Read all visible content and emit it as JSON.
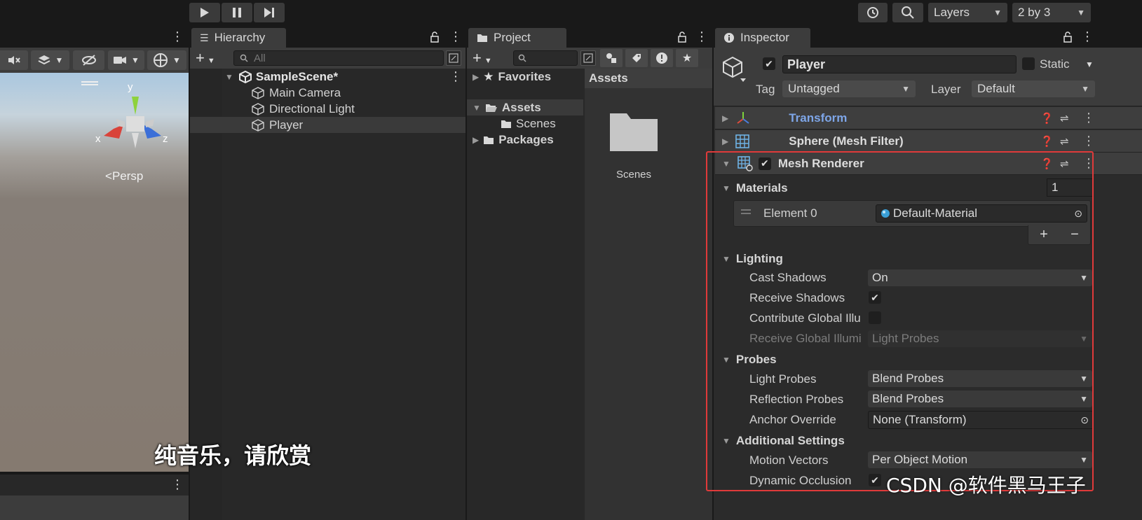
{
  "toolbar": {
    "layers_label": "Layers",
    "layout_label": "2 by 3"
  },
  "scene": {
    "persp_label": "Persp",
    "gizmo": {
      "y": "y",
      "x": "x",
      "z": "z"
    }
  },
  "hierarchy": {
    "tab_label": "Hierarchy",
    "search_placeholder": "All",
    "scene_name": "SampleScene*",
    "items": [
      "Main Camera",
      "Directional Light",
      "Player"
    ]
  },
  "project": {
    "tab_label": "Project",
    "favorites": "Favorites",
    "assets": "Assets",
    "scenes": "Scenes",
    "packages": "Packages",
    "assets_header": "Assets",
    "folder_label": "Scenes"
  },
  "inspector": {
    "tab_label": "Inspector",
    "object_name": "Player",
    "static_label": "Static",
    "tag_label": "Tag",
    "tag_value": "Untagged",
    "layer_label": "Layer",
    "layer_value": "Default",
    "components": {
      "transform": "Transform",
      "mesh_filter": "Sphere (Mesh Filter)",
      "mesh_renderer": "Mesh Renderer"
    },
    "materials": {
      "label": "Materials",
      "count": "1",
      "element_label": "Element 0",
      "element_value": "Default-Material"
    },
    "lighting": {
      "label": "Lighting",
      "cast_shadows_label": "Cast Shadows",
      "cast_shadows_value": "On",
      "receive_shadows_label": "Receive Shadows",
      "contribute_gi_label": "Contribute Global Illu",
      "receive_gi_label": "Receive Global Illumi",
      "receive_gi_value": "Light Probes"
    },
    "probes": {
      "label": "Probes",
      "light_probes_label": "Light Probes",
      "light_probes_value": "Blend Probes",
      "reflection_probes_label": "Reflection Probes",
      "reflection_probes_value": "Blend Probes",
      "anchor_override_label": "Anchor Override",
      "anchor_override_value": "None (Transform)"
    },
    "additional": {
      "label": "Additional Settings",
      "motion_vectors_label": "Motion Vectors",
      "motion_vectors_value": "Per Object Motion",
      "dynamic_occlusion_label": "Dynamic Occlusion"
    }
  },
  "overlay": {
    "subtitle": "纯音乐，请欣赏",
    "watermark": "CSDN @软件黑马王子"
  },
  "colors": {
    "highlight_box": "#e03a3a",
    "transform_blue": "#7ea6e8",
    "checkbox_bg": "#1f1f1f"
  }
}
